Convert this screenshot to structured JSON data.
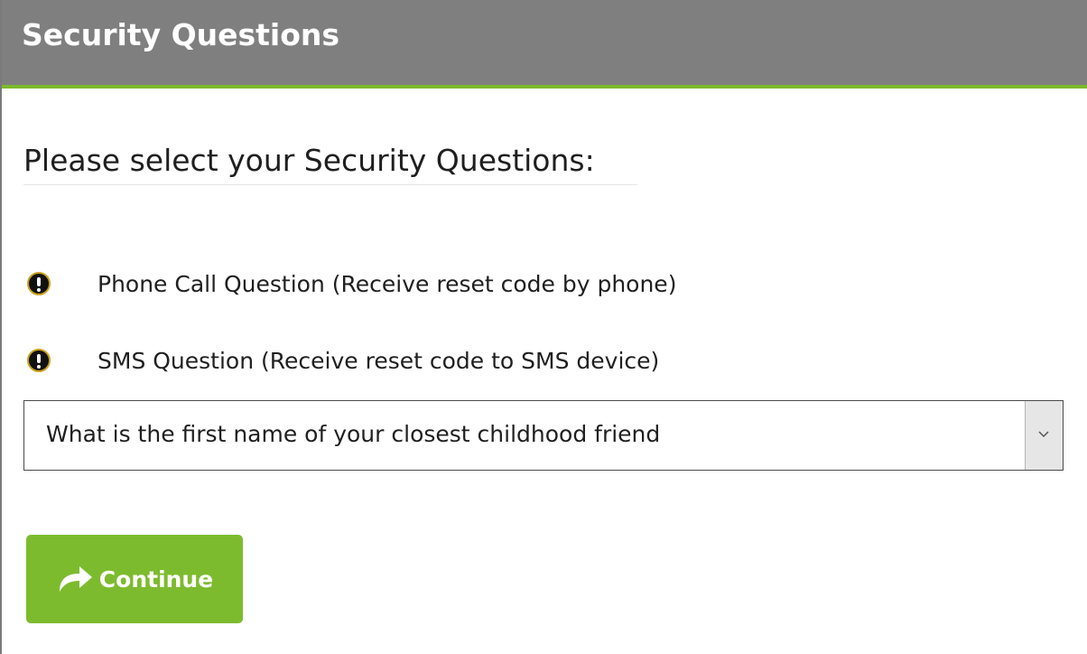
{
  "header": {
    "title": "Security Questions"
  },
  "main": {
    "subtitle": "Please select your Security Questions:",
    "options": [
      {
        "label": "Phone Call Question (Receive reset code by phone)",
        "icon": "warning-icon"
      },
      {
        "label": "SMS Question (Receive reset code to SMS device)",
        "icon": "warning-icon"
      }
    ],
    "question_select": {
      "value": "What is the first name of your closest childhood friend",
      "icon": "chevron-down-icon"
    },
    "continue_button": {
      "label": "Continue",
      "icon": "forward-arrow-icon"
    }
  },
  "colors": {
    "header_bg": "#7f7f7f",
    "accent_green": "#7dbb2e",
    "text": "#1f1f1f"
  }
}
